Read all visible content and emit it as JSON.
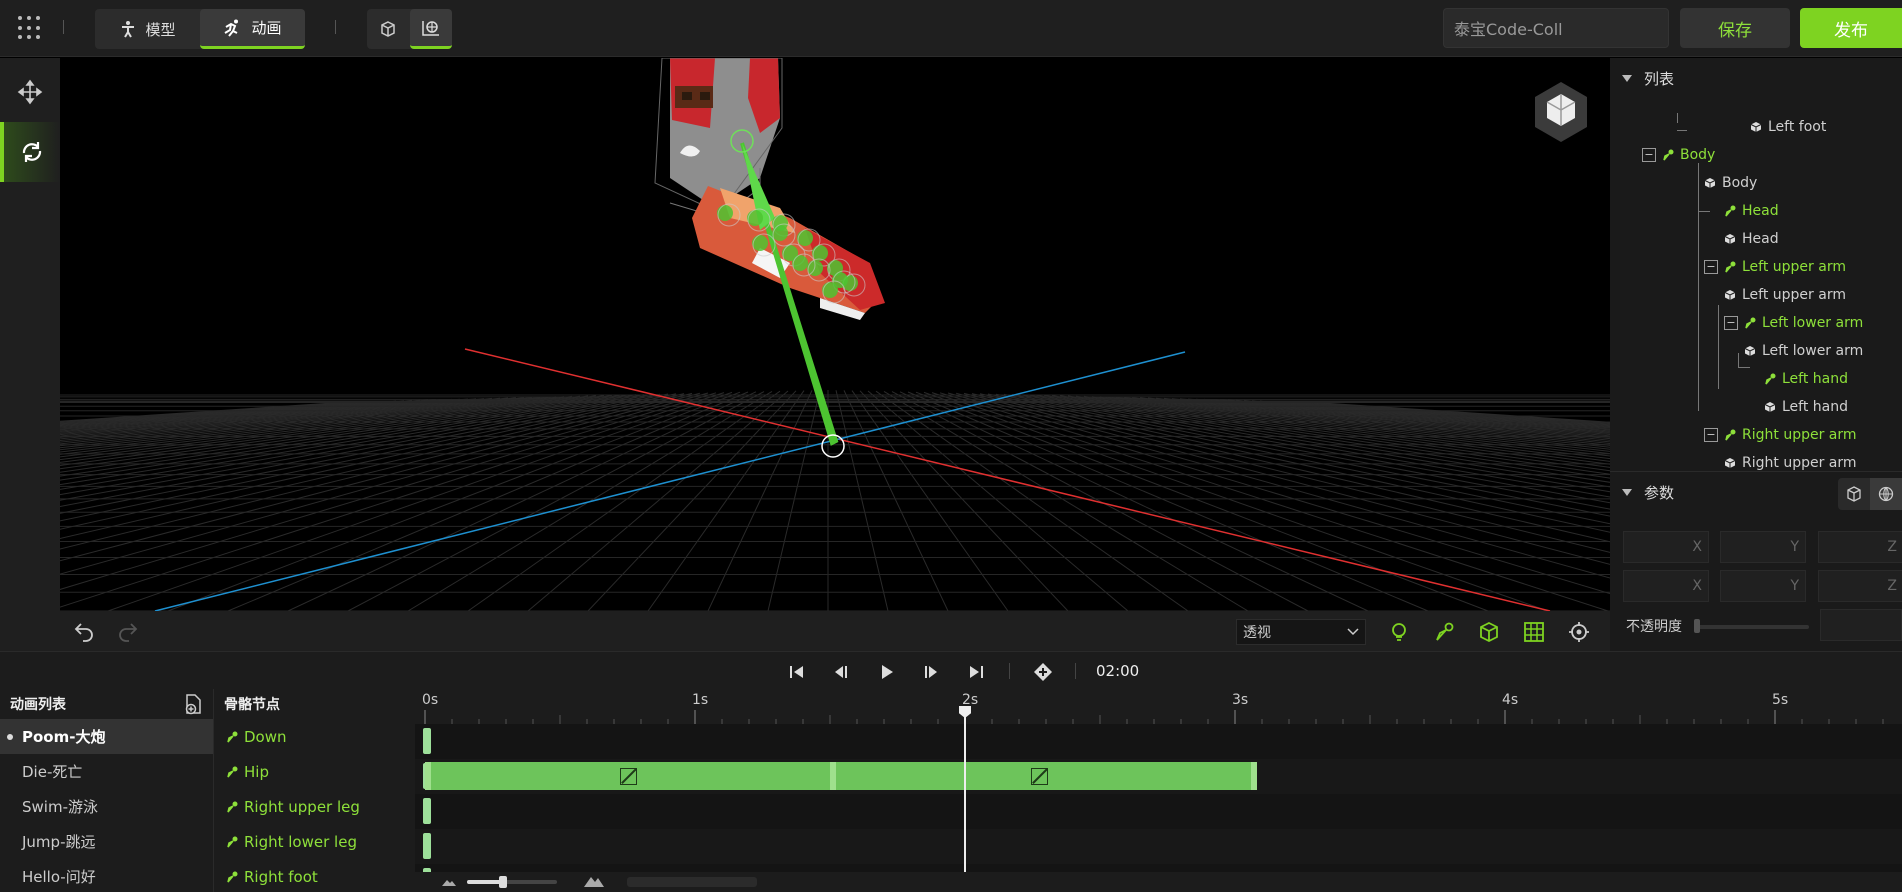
{
  "topbar": {
    "modes": [
      {
        "label": "模型",
        "icon": "person-icon",
        "active": false
      },
      {
        "label": "动画",
        "icon": "running-icon",
        "active": true
      }
    ],
    "views": [
      {
        "icon": "cube-icon",
        "active": false
      },
      {
        "icon": "globe-icon",
        "active": true
      }
    ],
    "project_name": "泰宝Code-Coll",
    "save_label": "保存",
    "publish_label": "发布",
    "accent": "#7ed321"
  },
  "left_tools": [
    {
      "icon": "move-icon",
      "active": false
    },
    {
      "icon": "rotate-icon",
      "active": true
    }
  ],
  "viewport": {
    "projection": "透视",
    "axis_x_color": "#e03030",
    "axis_z_color": "#1e90d0",
    "bone_color": "#4dc431"
  },
  "tree": {
    "title": "列表",
    "rows": [
      {
        "label": "Left foot",
        "type": "mesh"
      },
      {
        "label": "Body",
        "type": "bone",
        "collapsible": true
      },
      {
        "label": "Body",
        "type": "mesh"
      },
      {
        "label": "Head",
        "type": "bone"
      },
      {
        "label": "Head",
        "type": "mesh"
      },
      {
        "label": "Left upper arm",
        "type": "bone",
        "collapsible": true
      },
      {
        "label": "Left upper arm",
        "type": "mesh"
      },
      {
        "label": "Left lower arm",
        "type": "bone",
        "collapsible": true
      },
      {
        "label": "Left lower arm",
        "type": "mesh"
      },
      {
        "label": "Left hand",
        "type": "bone"
      },
      {
        "label": "Left hand",
        "type": "mesh"
      },
      {
        "label": "Right upper arm",
        "type": "bone",
        "collapsible": true
      },
      {
        "label": "Right upper arm",
        "type": "mesh"
      }
    ]
  },
  "params": {
    "title": "参数",
    "axes": [
      "X",
      "Y",
      "Z"
    ],
    "opacity_label": "不透明度",
    "opacity_value": 0
  },
  "playback": {
    "time": "02:00"
  },
  "animations": {
    "title": "动画列表",
    "items": [
      {
        "label": "Poom-大炮",
        "active": true
      },
      {
        "label": "Die-死亡",
        "active": false
      },
      {
        "label": "Swim-游泳",
        "active": false
      },
      {
        "label": "Jump-跳远",
        "active": false
      },
      {
        "label": "Hello-问好",
        "active": false
      }
    ]
  },
  "bones": {
    "title": "骨骼节点",
    "items": [
      "Down",
      "Hip",
      "Right upper leg",
      "Right lower leg",
      "Right foot"
    ]
  },
  "timeline": {
    "ticks": [
      "0s",
      "1s",
      "2s",
      "3s",
      "4s",
      "5s"
    ],
    "playhead_seconds": 2.0,
    "hip_clip_seconds": [
      0,
      3.05
    ],
    "hip_split_seconds": 1.5
  }
}
